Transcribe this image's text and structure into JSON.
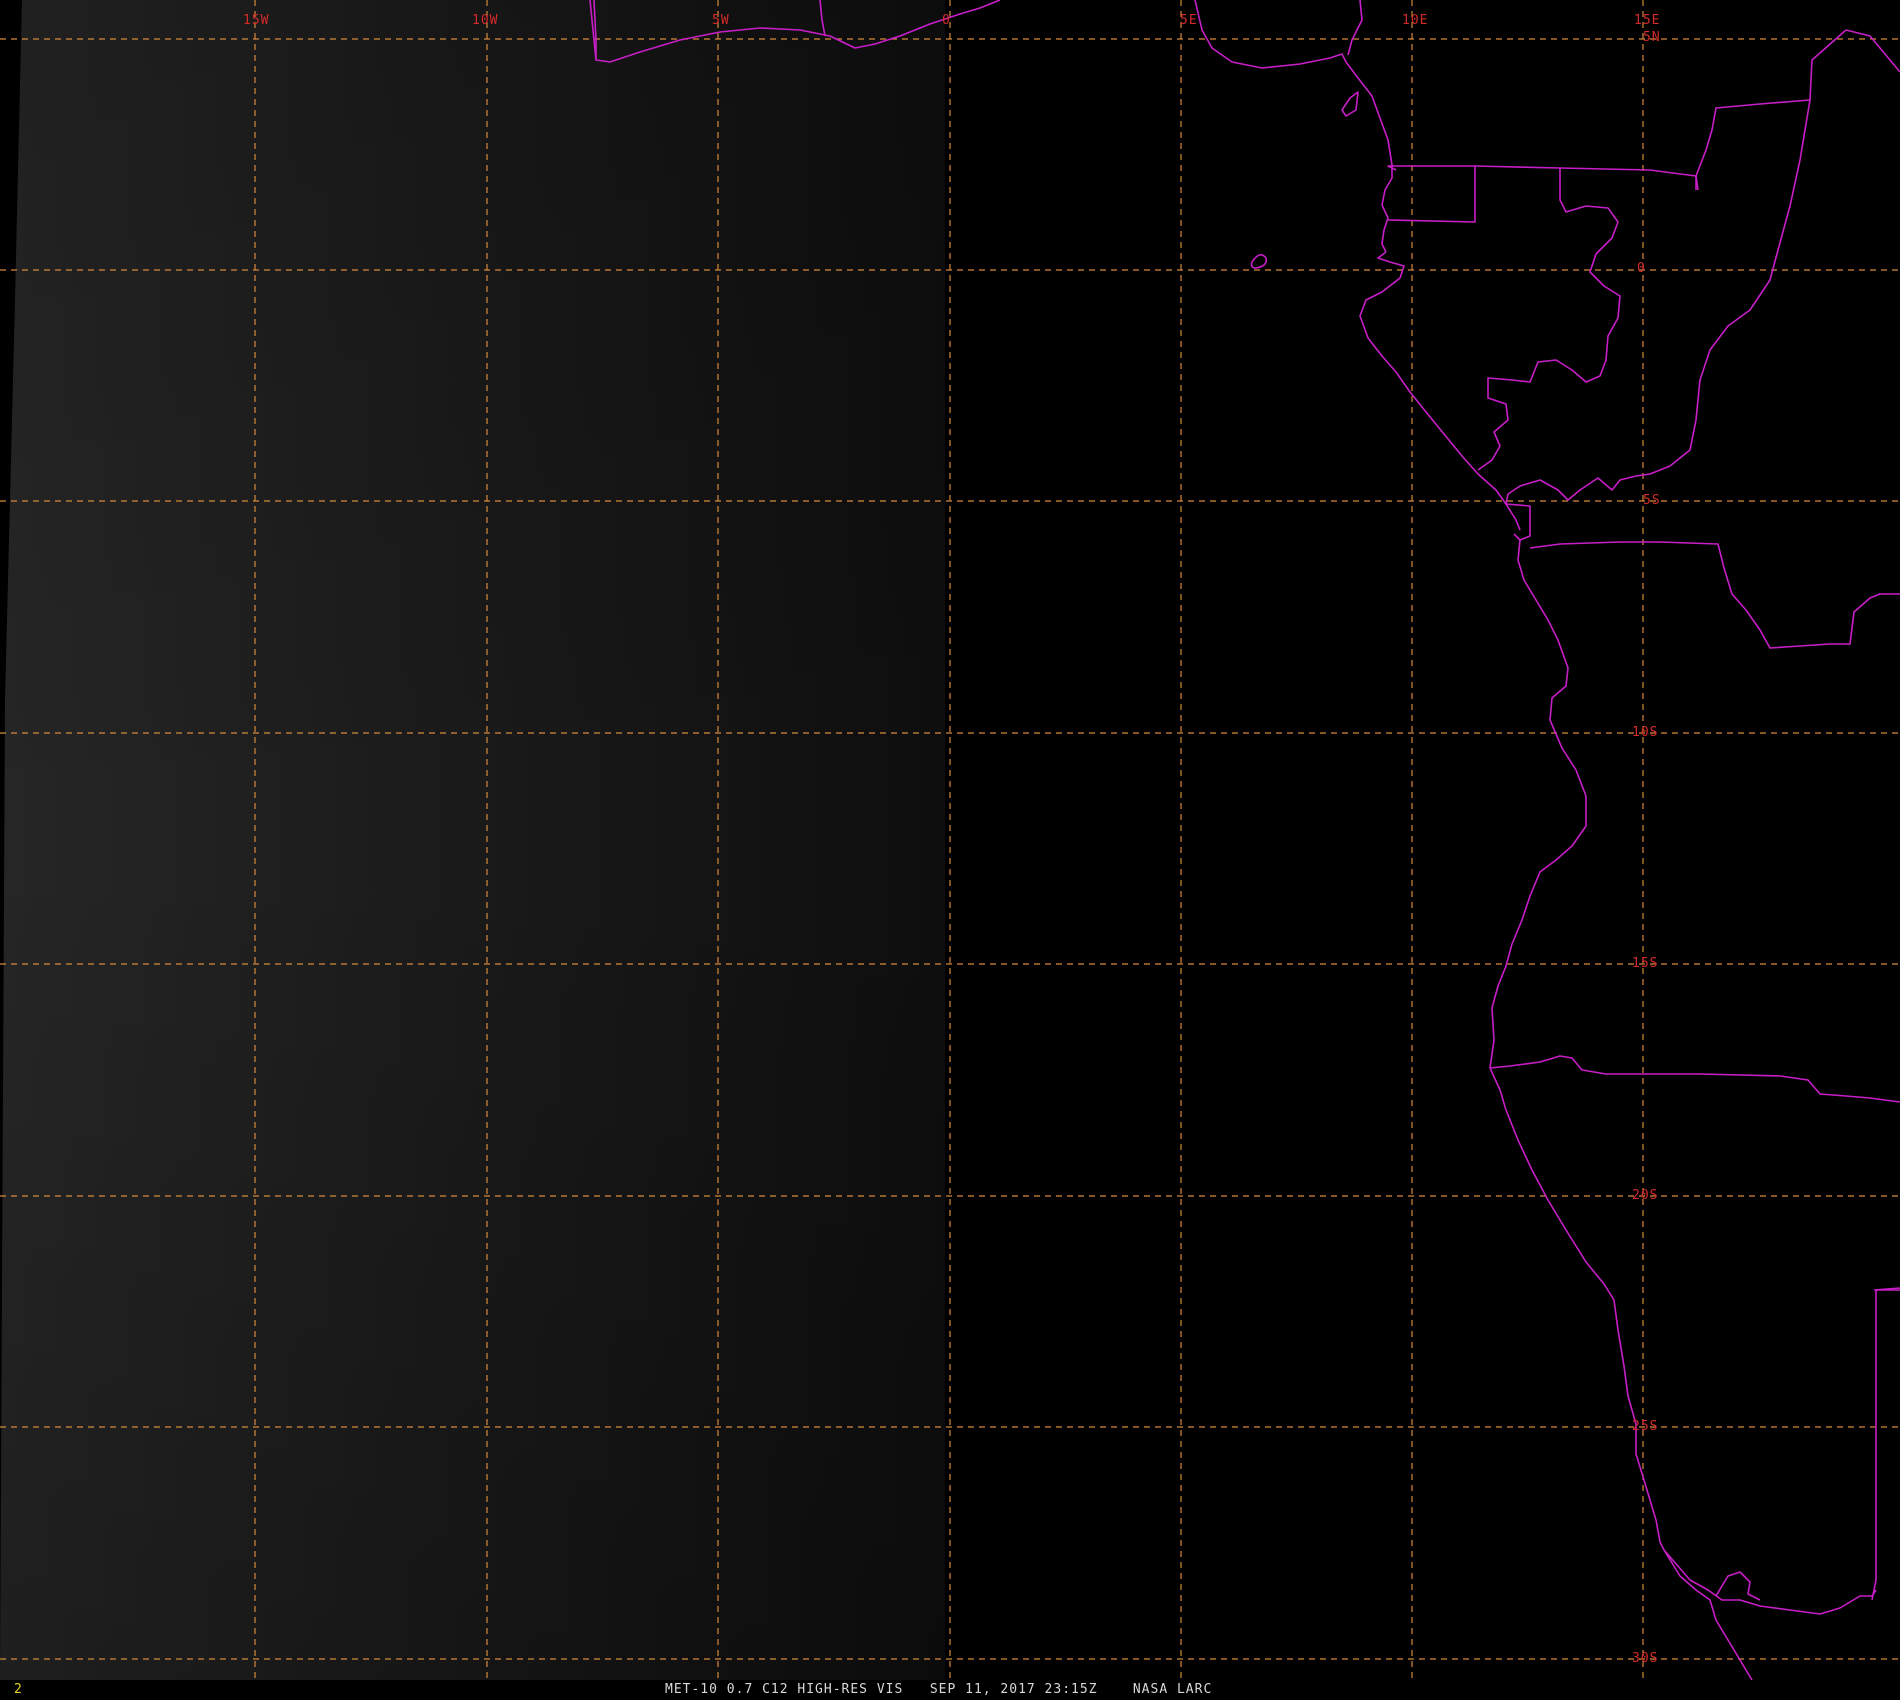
{
  "image": {
    "colors": {
      "background": "#000000",
      "vis_region": "#141414",
      "boundaries": "#c81ec8",
      "grid": "#d68a3c",
      "grid_labels": "#d42a2a",
      "frame_number": "#e6d21e",
      "caption": "#d8d8d8"
    }
  },
  "map": {
    "projection": "satellite",
    "longitude_labels": [
      "15W",
      "10W",
      "5W",
      "0",
      "5E",
      "10E",
      "15E"
    ],
    "latitude_labels": [
      "5N",
      "0",
      "5S",
      "10S",
      "15S",
      "20S",
      "25S",
      "30S"
    ],
    "graticule": "dashed",
    "overlays": [
      "coastlines",
      "country-borders"
    ]
  },
  "status_bar": {
    "frame_number": "2",
    "product": "MET-10 0.7 C12 HIGH-RES VIS",
    "timestamp": "SEP 11, 2017 23:15Z",
    "source": "NASA LARC"
  }
}
